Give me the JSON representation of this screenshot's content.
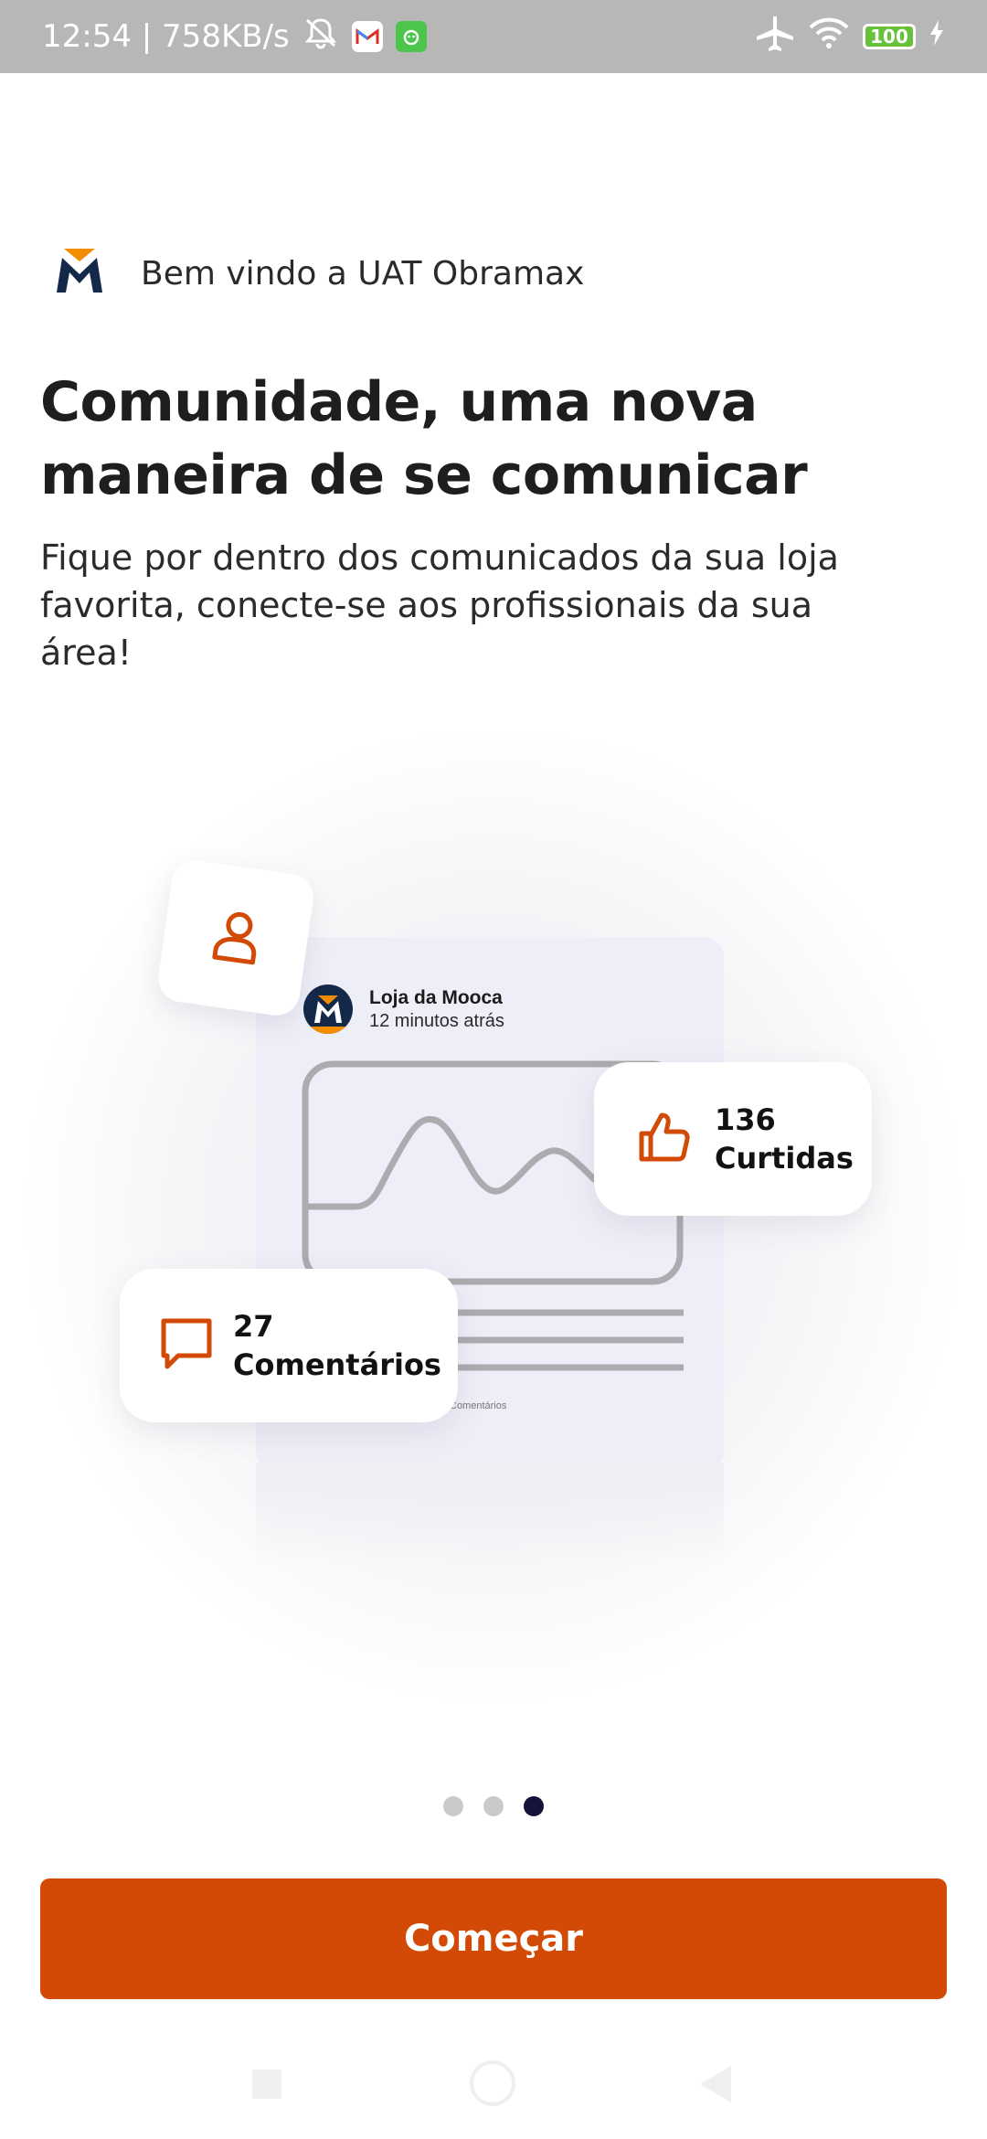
{
  "status_bar": {
    "time_speed": "12:54 | 758KB/s",
    "battery": "100",
    "icons": [
      "mute-icon",
      "gmail-icon",
      "notification-app-icon",
      "airplane-icon",
      "wifi-icon",
      "battery-icon",
      "charging-icon"
    ]
  },
  "header": {
    "brand_text": "Bem vindo a UAT Obramax"
  },
  "onboarding": {
    "title": "Comunidade, uma nova maneira de se comunicar",
    "subtitle": "Fique por dentro dos comunicados da sua loja favorita, conecte-se aos profissionais da sua área!"
  },
  "illustration": {
    "post": {
      "store_name": "Loja da Mooca",
      "time_ago": "12 minutos atrás",
      "tiny_label": "Comentários"
    },
    "likes": {
      "count": "136",
      "label": "Curtidas"
    },
    "comments": {
      "count": "27",
      "label": "Comentários"
    }
  },
  "pager": {
    "total": 3,
    "active_index": 2
  },
  "cta": {
    "label": "Começar"
  },
  "colors": {
    "accent": "#d24a06",
    "brand_navy": "#14284a",
    "brand_orange": "#f28c00",
    "dot_active": "#14123a"
  }
}
